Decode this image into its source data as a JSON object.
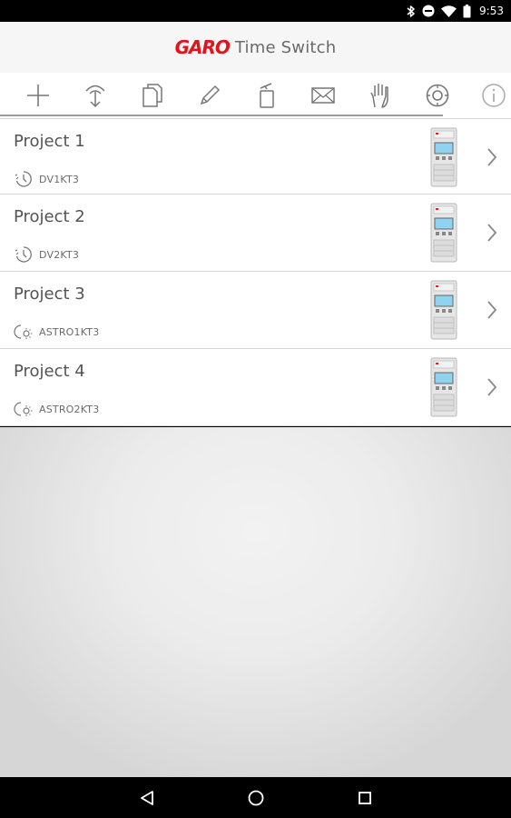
{
  "status_bar": {
    "time": "9:53",
    "icons": [
      "bluetooth-icon",
      "do-not-disturb-icon",
      "wifi-icon",
      "battery-icon"
    ]
  },
  "header": {
    "brand": "GARO",
    "title": "Time Switch",
    "brand_color": "#e3131b"
  },
  "toolbar": {
    "tools": [
      {
        "name": "add-icon"
      },
      {
        "name": "transfer-icon"
      },
      {
        "name": "copy-icon"
      },
      {
        "name": "edit-icon"
      },
      {
        "name": "delete-icon"
      },
      {
        "name": "email-icon"
      },
      {
        "name": "manual-control-icon"
      },
      {
        "name": "settings-icon"
      },
      {
        "name": "info-icon"
      }
    ]
  },
  "projects": [
    {
      "name": "Project 1",
      "device_type": "DV1KT3",
      "device_icon": "clock-icon"
    },
    {
      "name": "Project 2",
      "device_type": "DV2KT3",
      "device_icon": "clock-icon"
    },
    {
      "name": "Project 3",
      "device_type": "ASTRO1KT3",
      "device_icon": "astro-sun-icon"
    },
    {
      "name": "Project 4",
      "device_type": "ASTRO2KT3",
      "device_icon": "astro-sun-icon"
    }
  ],
  "nav": {
    "buttons": [
      "back-icon",
      "home-icon",
      "recents-icon"
    ]
  }
}
